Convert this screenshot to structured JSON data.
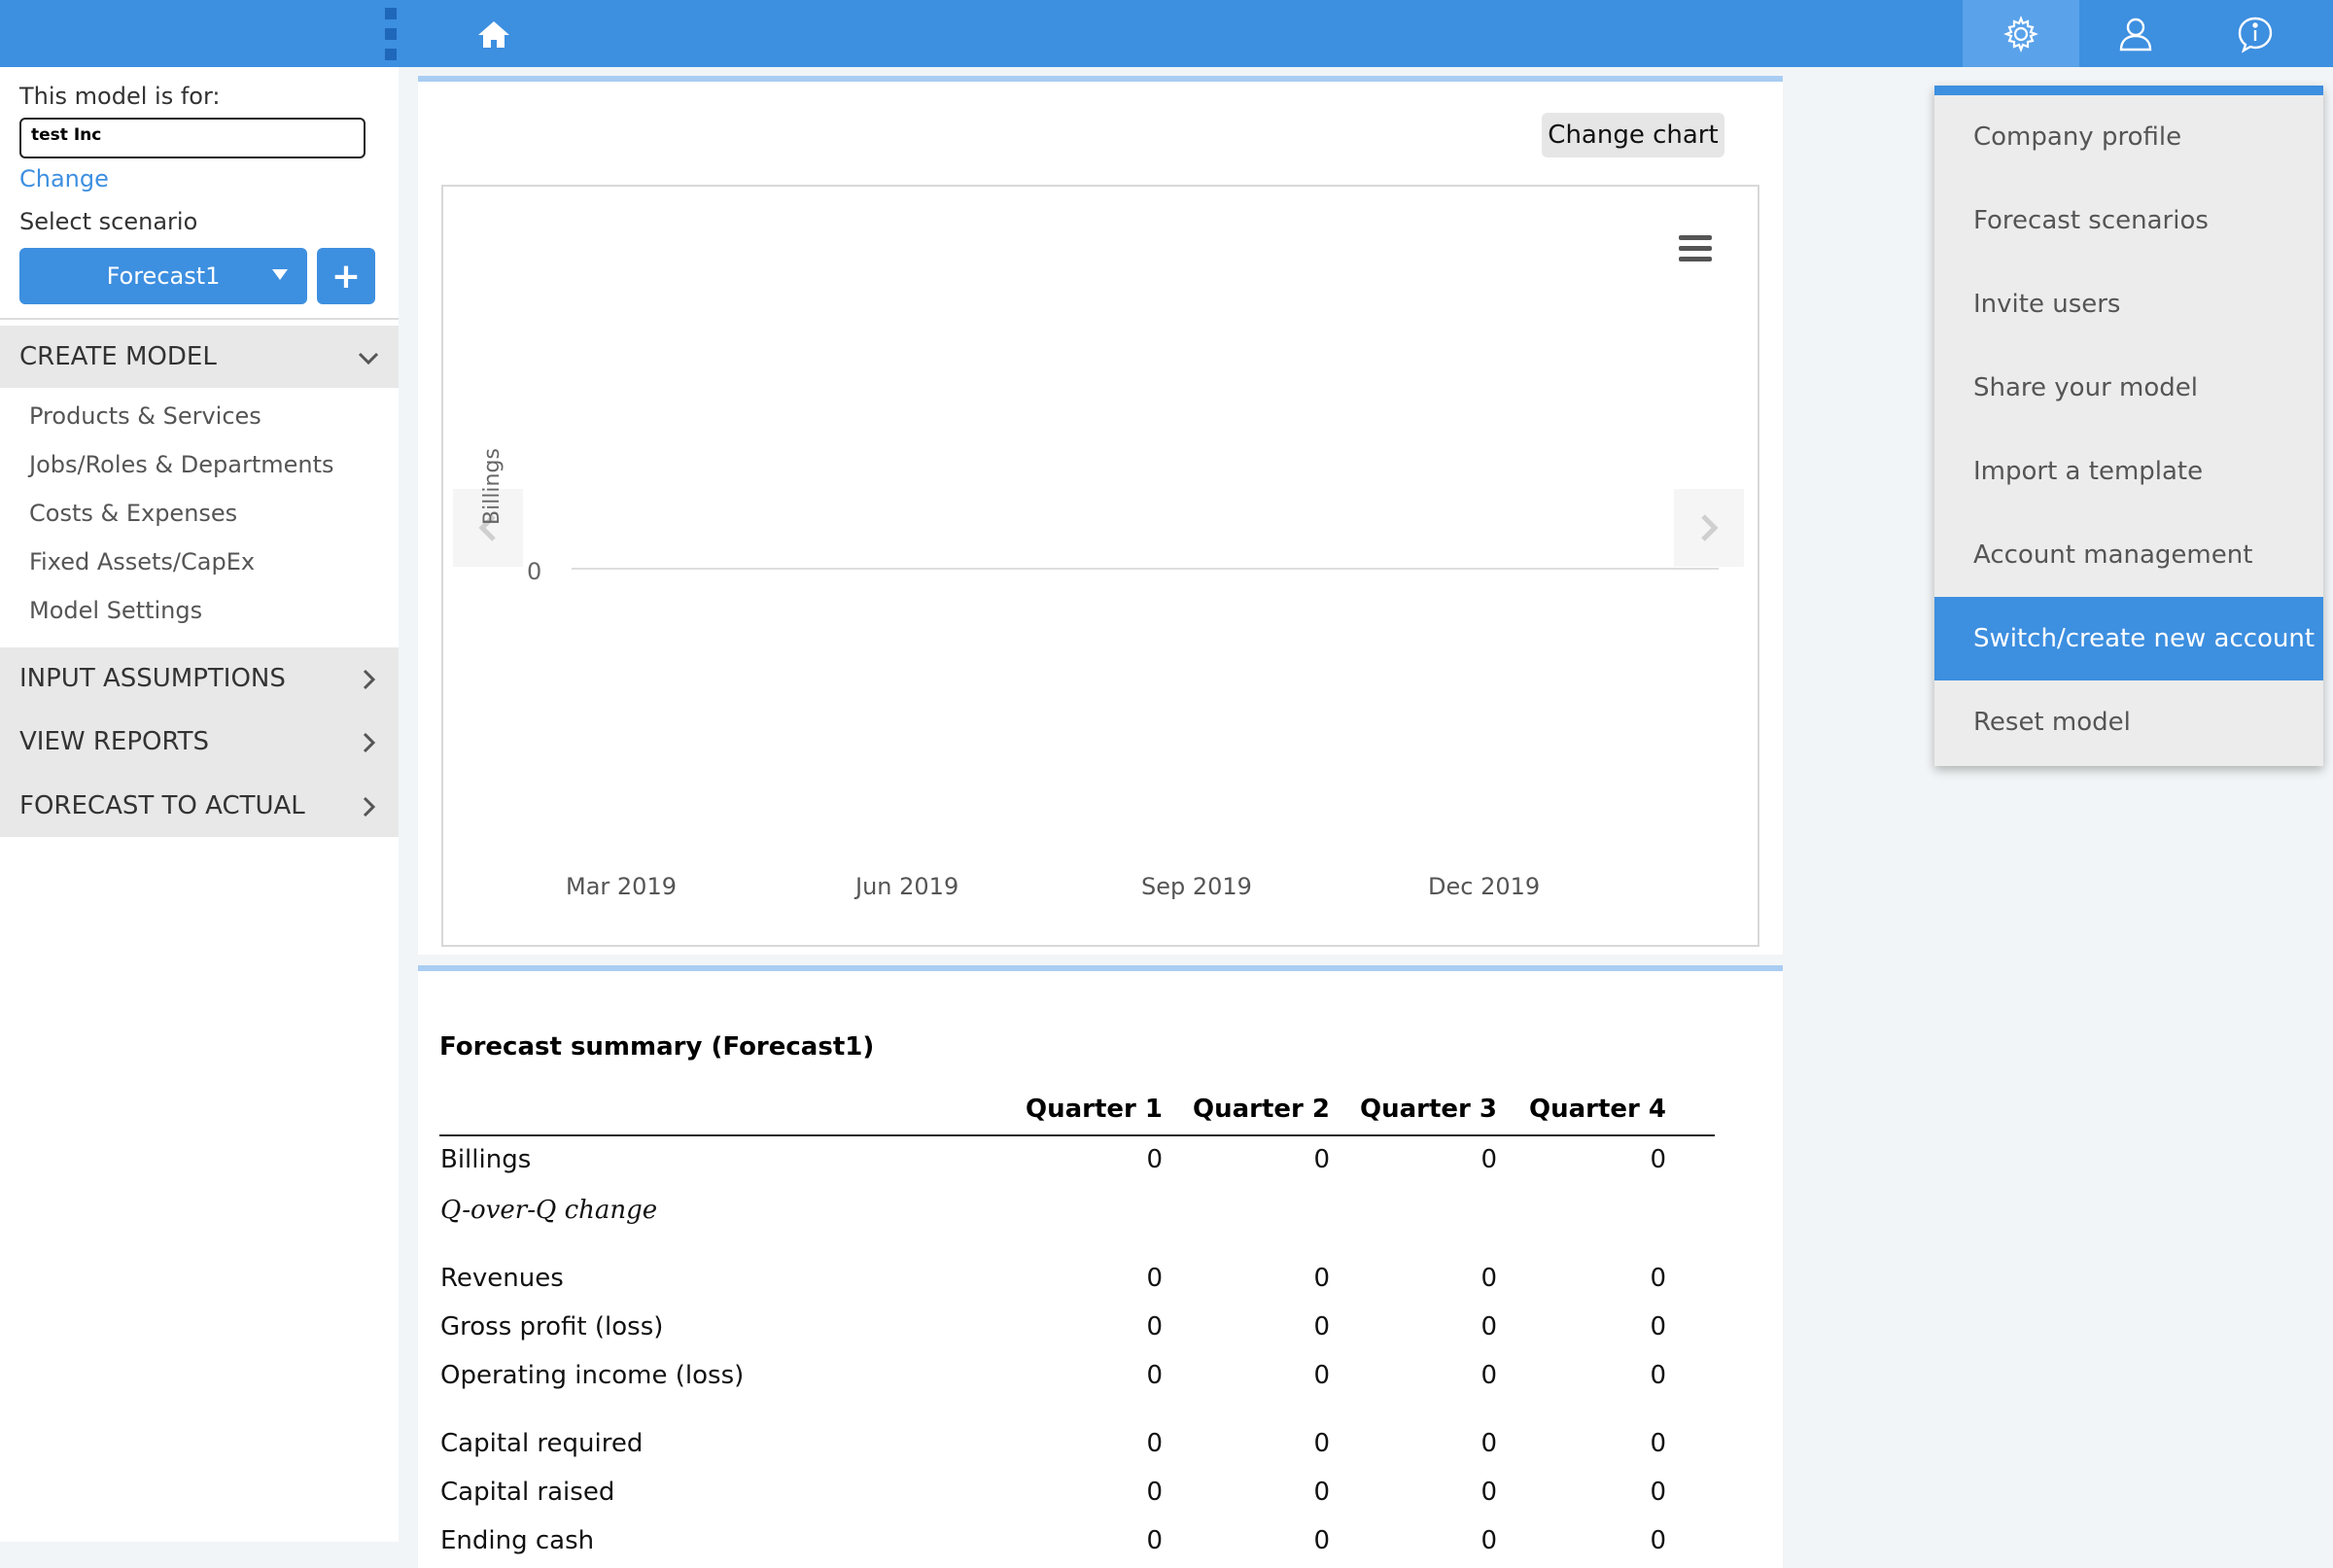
{
  "topbar": {
    "home_icon": "home-icon",
    "right_icons": [
      {
        "name": "gear-icon",
        "active": true
      },
      {
        "name": "user-icon",
        "active": false
      },
      {
        "name": "info-icon",
        "active": false
      }
    ],
    "accent_color": "#3d8fe0"
  },
  "sidebar": {
    "model_for_label": "This model is for:",
    "company_value": "test Inc",
    "change_link": "Change",
    "select_scenario_label": "Select scenario",
    "scenario_value": "Forecast1",
    "add_button": "+",
    "sections": [
      {
        "label": "CREATE MODEL",
        "expanded": true
      },
      {
        "label": "INPUT ASSUMPTIONS",
        "expanded": false
      },
      {
        "label": "VIEW REPORTS",
        "expanded": false
      },
      {
        "label": "FORECAST TO ACTUAL",
        "expanded": false
      }
    ],
    "create_model_items": [
      "Products & Services",
      "Jobs/Roles & Departments",
      "Costs & Expenses",
      "Fixed Assets/CapEx",
      "Model Settings"
    ]
  },
  "chart_panel": {
    "change_chart_button": "Change chart"
  },
  "chart_data": {
    "type": "line",
    "title": "",
    "xlabel": "",
    "ylabel": "Billings",
    "x_ticks": [
      "Mar 2019",
      "Jun 2019",
      "Sep 2019",
      "Dec 2019"
    ],
    "y_ticks": [
      "0"
    ],
    "series": [],
    "grid": false
  },
  "summary": {
    "title": "Forecast summary (Forecast1)",
    "columns": [
      "Quarter 1",
      "Quarter 2",
      "Quarter 3",
      "Quarter 4"
    ],
    "rows": [
      {
        "label": "Billings",
        "italic": false,
        "values": [
          "0",
          "0",
          "0",
          "0"
        ]
      },
      {
        "label": "Q-over-Q change",
        "italic": true,
        "values": []
      },
      {
        "label": "Revenues",
        "italic": false,
        "values": [
          "0",
          "0",
          "0",
          "0"
        ]
      },
      {
        "label": "Gross profit (loss)",
        "italic": false,
        "values": [
          "0",
          "0",
          "0",
          "0"
        ]
      },
      {
        "label": "Operating income (loss)",
        "italic": false,
        "values": [
          "0",
          "0",
          "0",
          "0"
        ]
      },
      {
        "label": "Capital required",
        "italic": false,
        "values": [
          "0",
          "0",
          "0",
          "0"
        ]
      },
      {
        "label": "Capital raised",
        "italic": false,
        "values": [
          "0",
          "0",
          "0",
          "0"
        ]
      },
      {
        "label": "Ending cash",
        "italic": false,
        "values": [
          "0",
          "0",
          "0",
          "0"
        ]
      }
    ]
  },
  "dropdown": {
    "items": [
      {
        "label": "Company profile",
        "highlighted": false
      },
      {
        "label": "Forecast scenarios",
        "highlighted": false
      },
      {
        "label": "Invite users",
        "highlighted": false
      },
      {
        "label": "Share your model",
        "highlighted": false
      },
      {
        "label": "Import a template",
        "highlighted": false
      },
      {
        "label": "Account management",
        "highlighted": false
      },
      {
        "label": "Switch/create new account",
        "highlighted": true
      },
      {
        "label": "Reset model",
        "highlighted": false
      }
    ]
  }
}
